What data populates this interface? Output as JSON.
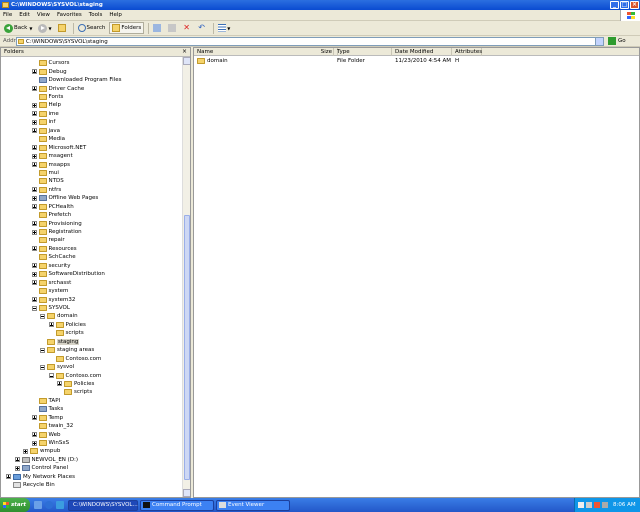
{
  "window": {
    "title": "C:\\WINDOWS\\SYSVOL\\staging"
  },
  "menu": [
    "File",
    "Edit",
    "View",
    "Favorites",
    "Tools",
    "Help"
  ],
  "toolbar": {
    "back": "Back",
    "search": "Search",
    "folders": "Folders"
  },
  "address": {
    "label": "Address",
    "value": "C:\\WINDOWS\\SYSVOL\\staging",
    "go": "Go"
  },
  "folders_pane": {
    "title": "Folders",
    "close": "×"
  },
  "tree": [
    {
      "label": "Cursors",
      "level": 3,
      "pm": "none"
    },
    {
      "label": "Debug",
      "level": 3,
      "pm": "plus"
    },
    {
      "label": "Downloaded Program Files",
      "level": 3,
      "pm": "none",
      "icon": "sysicon"
    },
    {
      "label": "Driver Cache",
      "level": 3,
      "pm": "plus"
    },
    {
      "label": "Fonts",
      "level": 3,
      "pm": "none"
    },
    {
      "label": "Help",
      "level": 3,
      "pm": "plus"
    },
    {
      "label": "ime",
      "level": 3,
      "pm": "plus"
    },
    {
      "label": "inf",
      "level": 3,
      "pm": "plus"
    },
    {
      "label": "java",
      "level": 3,
      "pm": "plus"
    },
    {
      "label": "Media",
      "level": 3,
      "pm": "none"
    },
    {
      "label": "Microsoft.NET",
      "level": 3,
      "pm": "plus"
    },
    {
      "label": "msagent",
      "level": 3,
      "pm": "plus"
    },
    {
      "label": "msapps",
      "level": 3,
      "pm": "plus"
    },
    {
      "label": "mui",
      "level": 3,
      "pm": "none"
    },
    {
      "label": "NTDS",
      "level": 3,
      "pm": "none"
    },
    {
      "label": "ntfrs",
      "level": 3,
      "pm": "plus"
    },
    {
      "label": "Offline Web Pages",
      "level": 3,
      "pm": "plus",
      "icon": "sysicon"
    },
    {
      "label": "PCHealth",
      "level": 3,
      "pm": "plus"
    },
    {
      "label": "Prefetch",
      "level": 3,
      "pm": "none"
    },
    {
      "label": "Provisioning",
      "level": 3,
      "pm": "plus"
    },
    {
      "label": "Registration",
      "level": 3,
      "pm": "plus"
    },
    {
      "label": "repair",
      "level": 3,
      "pm": "none"
    },
    {
      "label": "Resources",
      "level": 3,
      "pm": "plus"
    },
    {
      "label": "SchCache",
      "level": 3,
      "pm": "none"
    },
    {
      "label": "security",
      "level": 3,
      "pm": "plus"
    },
    {
      "label": "SoftwareDistribution",
      "level": 3,
      "pm": "plus"
    },
    {
      "label": "srchasst",
      "level": 3,
      "pm": "plus"
    },
    {
      "label": "system",
      "level": 3,
      "pm": "none"
    },
    {
      "label": "system32",
      "level": 3,
      "pm": "plus"
    },
    {
      "label": "SYSVOL",
      "level": 3,
      "pm": "minus"
    },
    {
      "label": "domain",
      "level": 4,
      "pm": "minus"
    },
    {
      "label": "Policies",
      "level": 5,
      "pm": "plus"
    },
    {
      "label": "scripts",
      "level": 5,
      "pm": "none"
    },
    {
      "label": "staging",
      "level": 4,
      "pm": "none",
      "selected": true
    },
    {
      "label": "staging areas",
      "level": 4,
      "pm": "minus"
    },
    {
      "label": "Contoso.com",
      "level": 5,
      "pm": "none"
    },
    {
      "label": "sysvol",
      "level": 4,
      "pm": "minus"
    },
    {
      "label": "Contoso.com",
      "level": 5,
      "pm": "minus"
    },
    {
      "label": "Policies",
      "level": 6,
      "pm": "plus"
    },
    {
      "label": "scripts",
      "level": 6,
      "pm": "none"
    },
    {
      "label": "TAPI",
      "level": 3,
      "pm": "none"
    },
    {
      "label": "Tasks",
      "level": 3,
      "pm": "none",
      "icon": "sysicon"
    },
    {
      "label": "Temp",
      "level": 3,
      "pm": "plus"
    },
    {
      "label": "twain_32",
      "level": 3,
      "pm": "none"
    },
    {
      "label": "Web",
      "level": 3,
      "pm": "plus"
    },
    {
      "label": "WinSxS",
      "level": 3,
      "pm": "plus"
    },
    {
      "label": "wmpub",
      "level": 2,
      "pm": "plus"
    },
    {
      "label": "NEWVOL_EN (D:)",
      "level": 1,
      "pm": "plus",
      "icon": "drive"
    },
    {
      "label": "Control Panel",
      "level": 1,
      "pm": "plus",
      "icon": "sysicon"
    },
    {
      "label": "My Network Places",
      "level": 0,
      "pm": "plus",
      "icon": "net"
    },
    {
      "label": "Recycle Bin",
      "level": 0,
      "pm": "none",
      "icon": "bin"
    }
  ],
  "list": {
    "columns": {
      "name": "Name",
      "size": "Size",
      "type": "Type",
      "modified": "Date Modified",
      "attributes": "Attributes"
    },
    "rows": [
      {
        "name": "domain",
        "size": "",
        "type": "File Folder",
        "modified": "11/23/2010 4:54 AM",
        "attributes": "H"
      }
    ]
  },
  "taskbar": {
    "start": "start",
    "tasks": [
      {
        "label": "C:\\WINDOWS\\SYSVOL...",
        "active": true
      },
      {
        "label": "Command Prompt",
        "active": false
      },
      {
        "label": "Event Viewer",
        "active": false
      }
    ],
    "clock": "8:06 AM"
  }
}
